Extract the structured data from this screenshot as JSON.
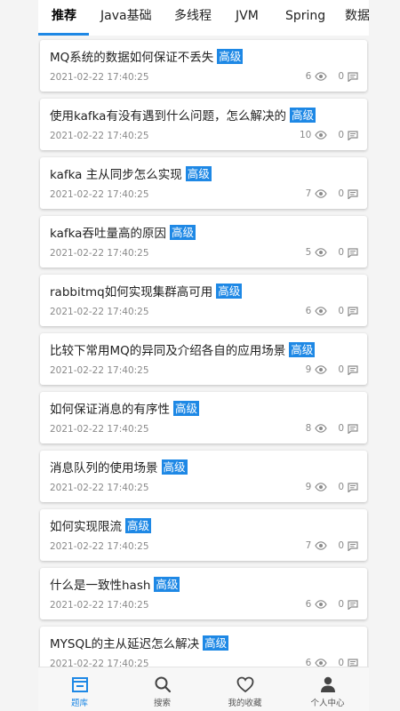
{
  "tabs": [
    {
      "label": "推荐",
      "active": true
    },
    {
      "label": "Java基础",
      "active": false
    },
    {
      "label": "多线程",
      "active": false
    },
    {
      "label": "JVM",
      "active": false
    },
    {
      "label": "Spring",
      "active": false
    },
    {
      "label": "数据",
      "active": false
    }
  ],
  "colors": {
    "accent": "#1e88e5",
    "meta": "#8a8a8a"
  },
  "questions": [
    {
      "title": "MQ系统的数据如何保证不丢失",
      "badge": "高级",
      "time": "2021-02-22 17:40:25",
      "views": "6",
      "comments": "0"
    },
    {
      "title": "使用kafka有没有遇到什么问题，怎么解决的",
      "badge": "高级",
      "time": "2021-02-22 17:40:25",
      "views": "10",
      "comments": "0"
    },
    {
      "title": "kafka 主从同步怎么实现",
      "badge": "高级",
      "time": "2021-02-22 17:40:25",
      "views": "7",
      "comments": "0"
    },
    {
      "title": "kafka吞吐量高的原因",
      "badge": "高级",
      "time": "2021-02-22 17:40:25",
      "views": "5",
      "comments": "0"
    },
    {
      "title": "rabbitmq如何实现集群高可用",
      "badge": "高级",
      "time": "2021-02-22 17:40:25",
      "views": "6",
      "comments": "0"
    },
    {
      "title": "比较下常用MQ的异同及介绍各自的应用场景",
      "badge": "高级",
      "time": "2021-02-22 17:40:25",
      "views": "9",
      "comments": "0"
    },
    {
      "title": "如何保证消息的有序性",
      "badge": "高级",
      "time": "2021-02-22 17:40:25",
      "views": "8",
      "comments": "0"
    },
    {
      "title": "消息队列的使用场景",
      "badge": "高级",
      "time": "2021-02-22 17:40:25",
      "views": "9",
      "comments": "0"
    },
    {
      "title": "如何实现限流",
      "badge": "高级",
      "time": "2021-02-22 17:40:25",
      "views": "7",
      "comments": "0"
    },
    {
      "title": "什么是一致性hash",
      "badge": "高级",
      "time": "2021-02-22 17:40:25",
      "views": "6",
      "comments": "0"
    },
    {
      "title": "MYSQL的主从延迟怎么解决",
      "badge": "高级",
      "time": "2021-02-22 17:40:25",
      "views": "6",
      "comments": "0"
    }
  ],
  "icons": {
    "views": "eye-icon",
    "comments": "comment-icon"
  },
  "bottom_nav": [
    {
      "label": "题库",
      "icon": "question-bank-icon",
      "active": true
    },
    {
      "label": "搜索",
      "icon": "search-icon",
      "active": false
    },
    {
      "label": "我的收藏",
      "icon": "heart-icon",
      "active": false
    },
    {
      "label": "个人中心",
      "icon": "person-icon",
      "active": false
    }
  ]
}
